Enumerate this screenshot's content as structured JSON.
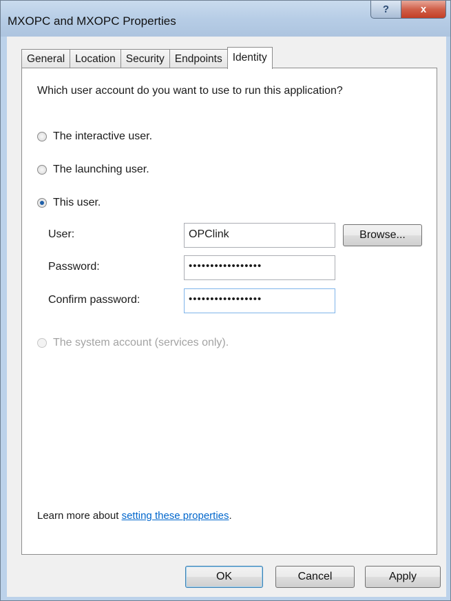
{
  "window": {
    "title": "MXOPC and MXOPC Properties"
  },
  "caption_buttons": {
    "help": "?",
    "close": "x"
  },
  "tabs": [
    {
      "label": "General",
      "active": false
    },
    {
      "label": "Location",
      "active": false
    },
    {
      "label": "Security",
      "active": false
    },
    {
      "label": "Endpoints",
      "active": false
    },
    {
      "label": "Identity",
      "active": true
    }
  ],
  "identity": {
    "question": "Which user account do you want to use to run this application?",
    "options": [
      {
        "label": "The interactive user.",
        "selected": false,
        "enabled": true
      },
      {
        "label": "The launching user.",
        "selected": false,
        "enabled": true
      },
      {
        "label": "This user.",
        "selected": true,
        "enabled": true
      },
      {
        "label": "The system account (services only).",
        "selected": false,
        "enabled": false
      }
    ],
    "user": {
      "label": "User:",
      "value": "OPClink"
    },
    "password": {
      "label": "Password:",
      "value": "•••••••••••••••••"
    },
    "confirm": {
      "label": "Confirm password:",
      "value": "•••••••••••••••••"
    },
    "browse_label": "Browse...",
    "learn_more_prefix": "Learn more about ",
    "learn_more_link": "setting these properties",
    "learn_more_suffix": "."
  },
  "footer": {
    "ok": "OK",
    "cancel": "Cancel",
    "apply": "Apply"
  }
}
